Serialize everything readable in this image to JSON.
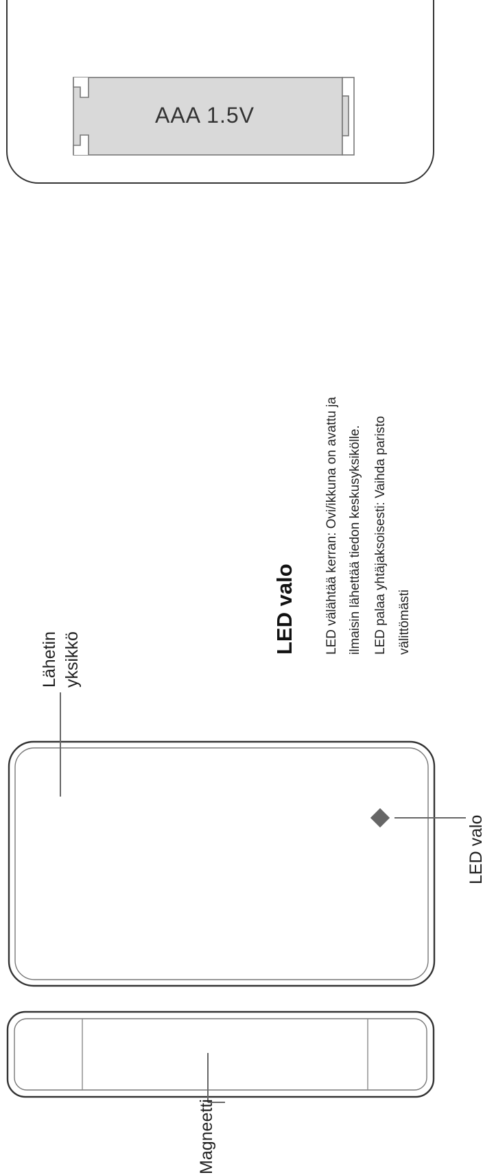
{
  "battery": {
    "label": "AAA  1.5V"
  },
  "led_section": {
    "heading": "LED valo",
    "lines": [
      "LED välähtää kerran: Ovi/ikkuna on avattu ja",
      "ilmaisin lähettää tiedon keskusyksikölle.",
      "LED palaa yhtäjaksoisesti: Vaihda paristo",
      "välittömästi"
    ]
  },
  "labels": {
    "transmitter_line1": "Lähetin",
    "transmitter_line2": "yksikkö",
    "led": "LED valo",
    "magnet": "Magneetti"
  },
  "colors": {
    "outline": "#333333",
    "battery_fill": "#d9d9d9",
    "led_diamond": "#666666",
    "leader": "#555555"
  }
}
